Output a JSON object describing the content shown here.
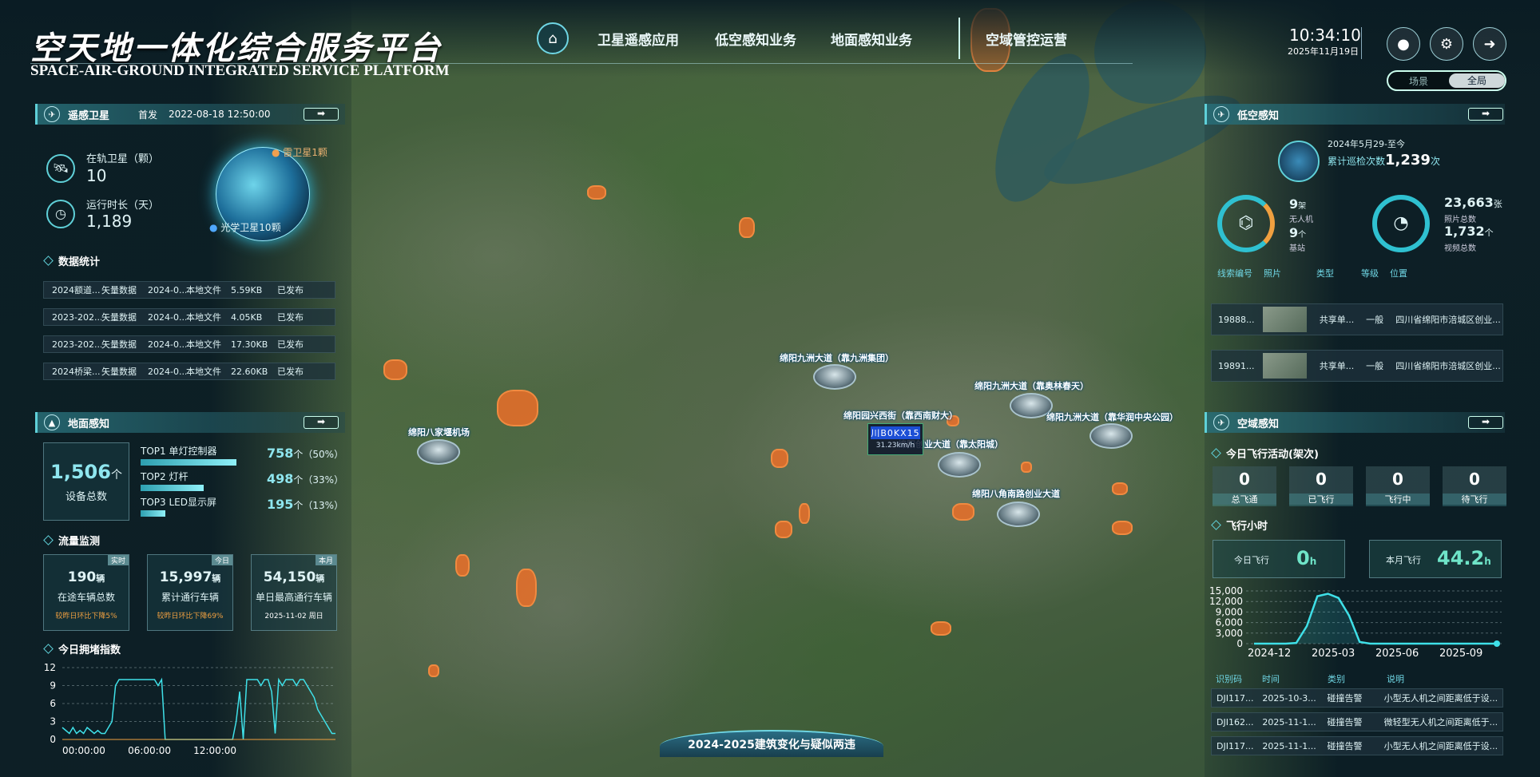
{
  "header": {
    "title_cn": "空天地一体化综合服务平台",
    "title_en": "SPACE-AIR-GROUND INTEGRATED SERVICE PLATFORM",
    "nav": [
      "卫星遥感应用",
      "低空感知业务",
      "地面感知业务",
      "空域管控运营"
    ],
    "time": "10:34:10",
    "date": "2025年11月19日",
    "toggle": [
      "场景",
      "全局"
    ]
  },
  "satellite": {
    "title": "遥感卫星",
    "launch_label": "首发",
    "launch_date": "2022-08-18 12:50:00",
    "orbit_label": "在轨卫星（颗）",
    "orbit_value": "10",
    "runtime_label": "运行时长（天）",
    "runtime_value": "1,189",
    "legend_radar": "雷卫星1颗",
    "legend_optical": "光学卫星10颗",
    "stats_title": "数据统计",
    "rows": [
      [
        "2024额道...",
        "矢量数据",
        "2024-0...",
        "本地文件",
        "5.59KB",
        "已发布"
      ],
      [
        "2023-202...",
        "矢量数据",
        "2024-0...",
        "本地文件",
        "4.05KB",
        "已发布"
      ],
      [
        "2023-202...",
        "矢量数据",
        "2024-0...",
        "本地文件",
        "17.30KB",
        "已发布"
      ],
      [
        "2024桥梁...",
        "矢量数据",
        "2024-0...",
        "本地文件",
        "22.60KB",
        "已发布"
      ]
    ]
  },
  "ground": {
    "title": "地面感知",
    "total_value": "1,506",
    "total_unit": "个",
    "total_label": "设备总数",
    "top": [
      {
        "rank": "TOP1",
        "name": "单灯控制器",
        "value": "758",
        "unit": "个",
        "pct": "（50%）",
        "ratio": 0.5
      },
      {
        "rank": "TOP2",
        "name": "灯杆",
        "value": "498",
        "unit": "个",
        "pct": "（33%）",
        "ratio": 0.33
      },
      {
        "rank": "TOP3",
        "name": "LED显示屏",
        "value": "195",
        "unit": "个",
        "pct": "（13%）",
        "ratio": 0.13
      }
    ],
    "flow_title": "流量监测",
    "flow": [
      {
        "tag": "实时",
        "value": "190",
        "unit": "辆",
        "label": "在途车辆总数",
        "note": "较昨日环比下降5%"
      },
      {
        "tag": "今日",
        "value": "15,997",
        "unit": "辆",
        "label": "累计通行车辆",
        "note": "较昨日环比下降69%"
      },
      {
        "tag": "本月",
        "value": "54,150",
        "unit": "辆",
        "label": "单日最高通行车辆",
        "note": "2025-11-02 周日"
      }
    ],
    "congestion_title": "今日拥堵指数"
  },
  "congestion_chart": {
    "type": "line",
    "x_ticks": [
      "00:00:00",
      "06:00:00",
      "12:00:00"
    ],
    "ylim": [
      0,
      12
    ],
    "y_ticks": [
      "12",
      "9",
      "6",
      "3",
      "0"
    ],
    "values": [
      2,
      1.5,
      1,
      2,
      1,
      1.5,
      1,
      2,
      1.5,
      1,
      1.5,
      1,
      1,
      2,
      3,
      9,
      10,
      10,
      10,
      10,
      10,
      10,
      10,
      10,
      10,
      10,
      10,
      9,
      10,
      0,
      0,
      0,
      0,
      0,
      0,
      0,
      0,
      0,
      0,
      0,
      0,
      0,
      0,
      0,
      0,
      0,
      0,
      0,
      0,
      3,
      8,
      0,
      10,
      10,
      10,
      10,
      9,
      10,
      10,
      8,
      1,
      10,
      9,
      10,
      10,
      10,
      9,
      10,
      10,
      9,
      8,
      7,
      5,
      4,
      3,
      2,
      1,
      1
    ]
  },
  "uav": {
    "title": "低空感知",
    "period": "2024年5月29-至今",
    "patrol_label": "累计巡检次数",
    "patrol_value": "1,239",
    "patrol_unit": "次",
    "drones_value": "9",
    "drones_unit": "架",
    "drones_label": "无人机",
    "bases_value": "9",
    "bases_unit": "个",
    "bases_label": "基站",
    "photos_value": "23,663",
    "photos_unit": "张",
    "photos_label": "照片总数",
    "videos_value": "1,732",
    "videos_unit": "个",
    "videos_label": "视频总数",
    "columns": [
      "线索编号",
      "照片",
      "类型",
      "等级",
      "位置"
    ],
    "rows": [
      [
        "19888...",
        "共享单...",
        "一般",
        "四川省绵阳市涪城区创业..."
      ],
      [
        "19891...",
        "共享单...",
        "一般",
        "四川省绵阳市涪城区创业..."
      ]
    ]
  },
  "airspace": {
    "title": "空域感知",
    "flight_title": "今日飞行活动(架次)",
    "counts": [
      {
        "value": "0",
        "label": "总飞通"
      },
      {
        "value": "0",
        "label": "已飞行"
      },
      {
        "value": "0",
        "label": "飞行中"
      },
      {
        "value": "0",
        "label": "待飞行"
      }
    ],
    "hours_title": "飞行小时",
    "today_label": "今日飞行",
    "today_value": "0",
    "today_unit": "h",
    "month_label": "本月飞行",
    "month_value": "44.2",
    "month_unit": "h",
    "columns": [
      "识别码",
      "时间",
      "类别",
      "说明"
    ],
    "rows": [
      [
        "DJI117...",
        "2025-10-3...",
        "碰撞告警",
        "小型无人机之间距离低于设..."
      ],
      [
        "DJI162...",
        "2025-11-1...",
        "碰撞告警",
        "微轻型无人机之间距离低于..."
      ],
      [
        "DJI117...",
        "2025-11-1...",
        "碰撞告警",
        "小型无人机之间距离低于设..."
      ]
    ]
  },
  "flight_chart": {
    "type": "area",
    "x_ticks": [
      "2024-12",
      "2025-03",
      "2025-06",
      "2025-09"
    ],
    "y_ticks": [
      "15,000",
      "12,000",
      "9,000",
      "6,000",
      "3,000",
      "0"
    ],
    "ylim": [
      0,
      15000
    ],
    "values": [
      0,
      0,
      0,
      0,
      200,
      5000,
      13500,
      14200,
      13000,
      8000,
      500,
      0,
      0,
      0,
      0,
      0,
      0,
      0,
      0,
      0,
      0,
      0,
      0,
      0
    ]
  },
  "map": {
    "labels": [
      "绵阳九洲大道（靠九洲集团）",
      "绵阳九洲大道（靠奥林春天）",
      "绵阳九洲大道（靠华润中央公园）",
      "绵阳园兴西街（靠西南财大）",
      "绵阳创业大道（靠太阳城）",
      "绵阳八家堰机场",
      "绵阳八角南路创业大道"
    ],
    "plate": "川B0KX15",
    "speed": "31.23km/h",
    "bottom_title": "2024-2025建筑变化与疑似两违"
  }
}
